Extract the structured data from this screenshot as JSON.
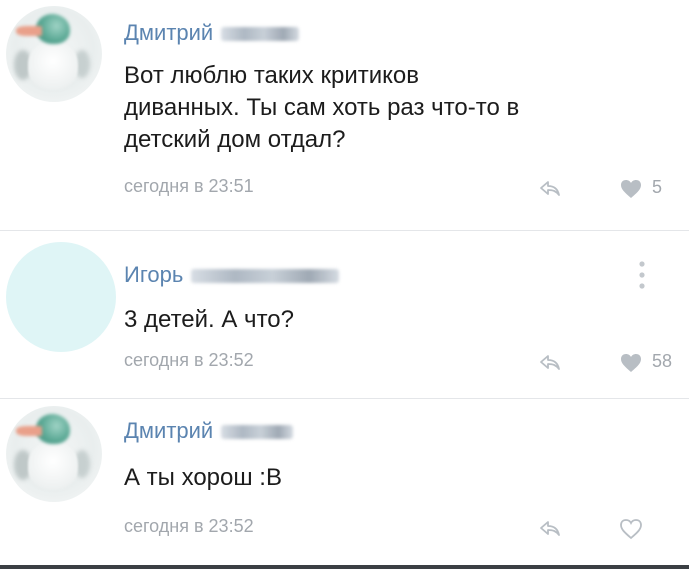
{
  "comments": [
    {
      "author": "Дмитрий",
      "text_lines": [
        "Вот люблю таких критиков",
        "диванных. Ты сам хоть раз что-то в",
        "детский дом отдал?"
      ],
      "time": "сегодня в 23:51",
      "likes": "5"
    },
    {
      "author": "Игорь",
      "text_lines": [
        "3 детей. А что?"
      ],
      "time": "сегодня в 23:52",
      "likes": "58"
    },
    {
      "author": "Дмитрий",
      "text_lines": [
        "А ты хорош :В"
      ],
      "time": "сегодня в 23:52",
      "likes": ""
    }
  ],
  "icons": {
    "reply": "reply-arrow-icon",
    "like": "heart-icon",
    "more": "more-vertical-icon"
  },
  "colors": {
    "author": "#5b84b0",
    "meta": "#a2a7ad",
    "icon": "#b8bec4",
    "avatar_circle": "#dff5f6"
  }
}
